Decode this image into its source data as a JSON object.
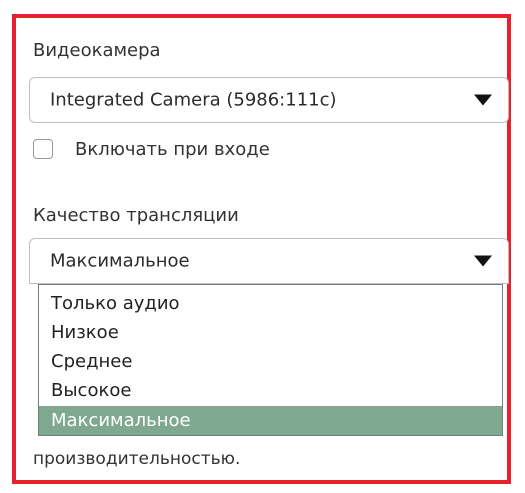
{
  "camera_label": "Видеокамера",
  "camera_select_value": "Integrated Camera (5986:111c)",
  "autostart_checkbox_label": "Включать при входе",
  "autostart_checked": false,
  "quality_label": "Качество трансляции",
  "quality_select_value": "Максимальное",
  "quality_options": [
    "Только аудио",
    "Низкое",
    "Среднее",
    "Высокое",
    "Максимальное"
  ],
  "quality_selected_index": 4,
  "partial_text": "производительностью.",
  "colors": {
    "highlight_border": "#e8202a",
    "selected_option_bg": "#7fa891"
  }
}
